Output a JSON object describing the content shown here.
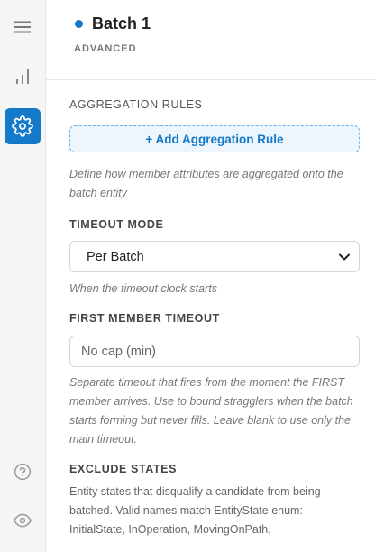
{
  "header": {
    "title": "Batch 1",
    "subtitle": "ADVANCED",
    "status_color": "#1479c9"
  },
  "rail": {
    "items": [
      {
        "icon": "hamburger-menu-icon"
      },
      {
        "icon": "bar-chart-icon"
      },
      {
        "icon": "gear-icon",
        "active": true
      },
      {
        "icon": "help-circle-icon"
      },
      {
        "icon": "eye-icon"
      }
    ],
    "active_color": "#1479c9"
  },
  "aggregation": {
    "title": "AGGREGATION RULES",
    "add_label": "+ Add Aggregation Rule",
    "hint": "Define how member attributes are aggregated onto the batch entity"
  },
  "timeout_mode": {
    "title": "TIMEOUT MODE",
    "selected": "Per Batch",
    "hint": "When the timeout clock starts"
  },
  "first_member_timeout": {
    "title": "FIRST MEMBER TIMEOUT",
    "placeholder": "No cap (min)",
    "hint": "Separate timeout that fires from the moment the FIRST member arrives. Use to bound stragglers when the batch starts forming but never fills. Leave blank to use only the main timeout."
  },
  "exclude_states": {
    "title": "EXCLUDE STATES",
    "description": "Entity states that disqualify a candidate from being batched. Valid names match EntityState enum: InitialState, InOperation, MovingOnPath,"
  }
}
